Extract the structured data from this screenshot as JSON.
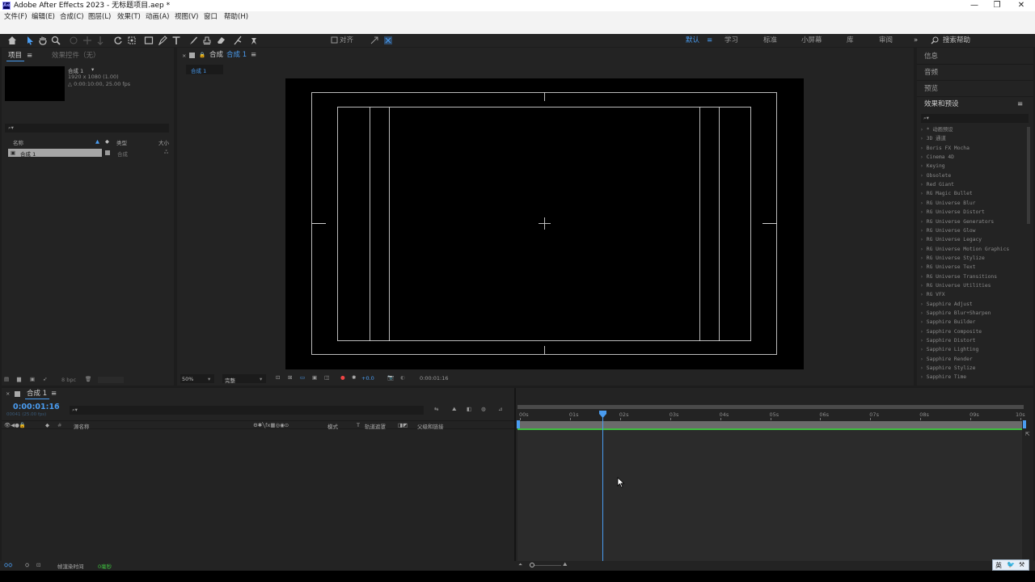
{
  "window": {
    "title": "Adobe After Effects 2023 - 无标题项目.aep *",
    "app_badge": "Ae"
  },
  "menu": [
    "文件(F)",
    "编辑(E)",
    "合成(C)",
    "图层(L)",
    "效果(T)",
    "动画(A)",
    "视图(V)",
    "窗口",
    "帮助(H)"
  ],
  "toolbar": {
    "align_label": "对齐"
  },
  "workspaces": [
    "默认",
    "学习",
    "标准",
    "小屏幕",
    "库",
    "审阅"
  ],
  "help_search_placeholder": "搜索帮助",
  "project_panel": {
    "tab_project": "项目",
    "tab_effects_controls": "效果控件（无）",
    "comp_name": "合成 1",
    "comp_info_line1": "1920 x 1080 (1.00)",
    "comp_info_line2": "△ 0:00:10:00, 25.00 fps",
    "search_placeholder": "",
    "col_name": "名称",
    "col_type": "类型",
    "col_size": "大小",
    "items": [
      {
        "name": "合成 1",
        "type": "合成"
      }
    ],
    "bpc": "8 bpc"
  },
  "composition_panel": {
    "tab_label": "合成",
    "comp_name": "合成 1",
    "breadcrumb": "合成 1",
    "zoom": "50%",
    "resolution": "完整",
    "exposure": "+0.0",
    "timecode": "0:00:01:16"
  },
  "right_panels": {
    "info": "信息",
    "audio": "音频",
    "preview": "预览",
    "effects_presets": "效果和预设",
    "search_placeholder": "",
    "effects": [
      "* 动画预设",
      "3D 通道",
      "Boris FX Mocha",
      "Cinema 4D",
      "Keying",
      "Obsolete",
      "Red Giant",
      "RG Magic Bullet",
      "RG Universe Blur",
      "RG Universe Distort",
      "RG Universe Generators",
      "RG Universe Glow",
      "RG Universe Legacy",
      "RG Universe Motion Graphics",
      "RG Universe Stylize",
      "RG Universe Text",
      "RG Universe Transitions",
      "RG Universe Utilities",
      "RG VFX",
      "Sapphire Adjust",
      "Sapphire Blur+Sharpen",
      "Sapphire Builder",
      "Sapphire Composite",
      "Sapphire Distort",
      "Sapphire Lighting",
      "Sapphire Render",
      "Sapphire Stylize",
      "Sapphire Time"
    ]
  },
  "timeline": {
    "comp_tab": "合成 1",
    "timecode": "0:00:01:16",
    "frame_info": "00041 (25.00 fps)",
    "search_placeholder": "",
    "col_source_name": "源名称",
    "col_mode": "模式",
    "col_t": "T",
    "col_track_matte": "轨道遮罩",
    "col_parent": "父级和链接",
    "ticks": [
      "00s",
      "01s",
      "02s",
      "03s",
      "04s",
      "05s",
      "06s",
      "07s",
      "08s",
      "09s",
      "10s"
    ],
    "playhead_seconds": 1.64,
    "duration_seconds": 10,
    "render_time_label": "帧渲染时间",
    "render_time_value": "0毫秒"
  },
  "ime": {
    "lang": "英"
  },
  "colors": {
    "accent_blue": "#2d8ceb",
    "green_bar": "#3fbf3f",
    "timecode_blue": "#4a9cf0"
  }
}
